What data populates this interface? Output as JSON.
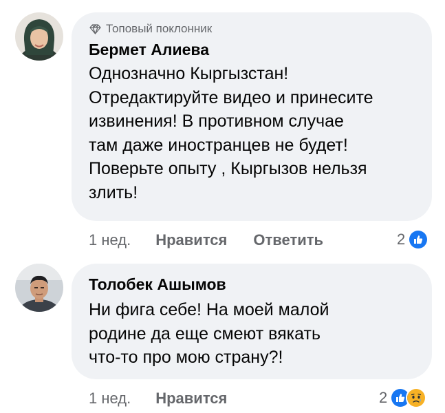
{
  "colors": {
    "bubble_bg": "#f0f2f5",
    "text_primary": "#050505",
    "text_secondary": "#65676b",
    "like_blue": "#1877f2",
    "sad_yellow": "#f7b125"
  },
  "comments": [
    {
      "badge_icon": "diamond-icon",
      "badge_label": "Топовый поклонник",
      "author": "Бермет Алиева",
      "text": "Однозначно Кыргызстан!\nОтредактируйте видео и принесите\nизвинения! В противном случае\nтам даже иностранцев не будет!\nПоверьте опыту , Кыргызов нельзя\nзлить!",
      "time": "1 нед.",
      "like_label": "Нравится",
      "reply_label": "Ответить",
      "reaction_count": "2",
      "reaction_icons": [
        "like-icon"
      ]
    },
    {
      "author": "Толобек Ашымов",
      "text": "Ни фига себе! На моей малой\nродине да еще смеют вякать\nчто-то про мою страну?!",
      "time": "1 нед.",
      "like_label": "Нравится",
      "reaction_count": "2",
      "reaction_icons": [
        "like-icon",
        "sad-icon"
      ]
    }
  ]
}
